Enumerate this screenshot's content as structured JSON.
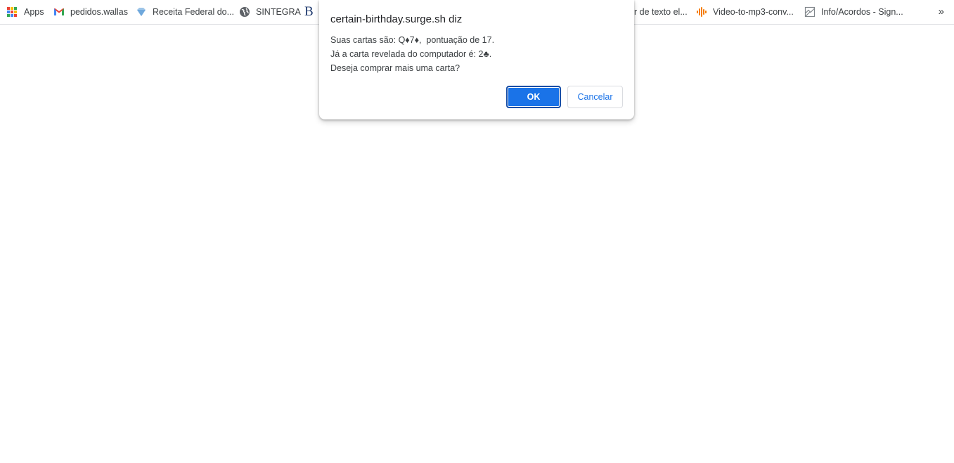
{
  "bookmarks": {
    "items": [
      {
        "label": "Apps",
        "icon": "apps-grid-icon"
      },
      {
        "label": "pedidos.wallas",
        "icon": "gmail-icon"
      },
      {
        "label": "Receita Federal do...",
        "icon": "receita-federal-icon"
      },
      {
        "label": "SINTEGRA",
        "icon": "globe-icon"
      },
      {
        "label": "",
        "icon": "b-logo-icon"
      },
      {
        "label": "r de texto el...",
        "icon": ""
      },
      {
        "label": "Video-to-mp3-conv...",
        "icon": "audio-wave-icon"
      },
      {
        "label": "Info/Acordos - Sign...",
        "icon": "broken-page-icon"
      }
    ],
    "overflow": "»"
  },
  "dialog": {
    "title": "certain-birthday.surge.sh diz",
    "lines": [
      "Suas cartas são: Q♦7♦,  pontuação de 17.",
      "Já a carta revelada do computador é: 2♣.",
      "Deseja comprar mais uma carta?"
    ],
    "ok_label": "OK",
    "cancel_label": "Cancelar"
  },
  "colors": {
    "accent": "#1a73e8",
    "orange_icon": "#f57c00"
  }
}
